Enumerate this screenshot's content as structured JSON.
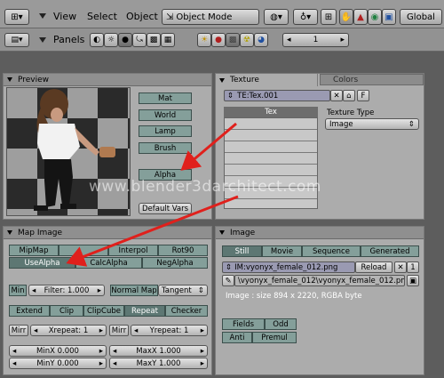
{
  "header": {
    "menus": [
      "View",
      "Select",
      "Object"
    ],
    "mode": "Object Mode",
    "orientation": "Global"
  },
  "panels_bar": {
    "label": "Panels",
    "frame": "1"
  },
  "preview": {
    "title": "Preview",
    "buttons": [
      "Mat",
      "World",
      "Lamp",
      "Brush"
    ],
    "alpha": "Alpha",
    "default_vars": "Default Vars"
  },
  "texture": {
    "tab_texture": "Texture",
    "tab_colors": "Colors",
    "name": "TE:Tex.001",
    "f_button": "F",
    "list_header": "Tex",
    "type_label": "Texture Type",
    "type_value": "Image"
  },
  "map_image": {
    "title": "Map Image",
    "row1": [
      "MipMap",
      "",
      "Interpol",
      "Rot90"
    ],
    "row2": [
      "UseAlpha",
      "CalcAlpha",
      "NegAlpha"
    ],
    "min": "Min",
    "filter": "Filter: 1.000",
    "normal_map": "Normal Map",
    "tangent": "Tangent",
    "extend_row": [
      "Extend",
      "Clip",
      "ClipCube",
      "Repeat",
      "Checker"
    ],
    "mirr1": "Mirr",
    "xrepeat": "Xrepeat: 1",
    "mirr2": "Mirr",
    "yrepeat": "Yrepeat: 1",
    "minx": "MinX 0.000",
    "maxx": "MaxX 1.000",
    "miny": "MinY 0.000",
    "maxy": "MaxY 1.000"
  },
  "image": {
    "title": "Image",
    "tabs": [
      "Still",
      "Movie",
      "Sequence",
      "Generated"
    ],
    "name": "IM:vyonyx_female_012.png",
    "reload": "Reload",
    "users": "1",
    "path": "\\vyonyx_female_012\\vyonyx_female_012.png",
    "size_info": "Image : size 894 x 2220, RGBA byte",
    "fields": "Fields",
    "odd": "Odd",
    "anti": "Anti",
    "premul": "Premul"
  },
  "watermark": "www.blender3darchitect.com",
  "colors": {
    "arrow": "#e0201c",
    "teal_button": "#849f9a",
    "teal_active": "#5d7773"
  }
}
